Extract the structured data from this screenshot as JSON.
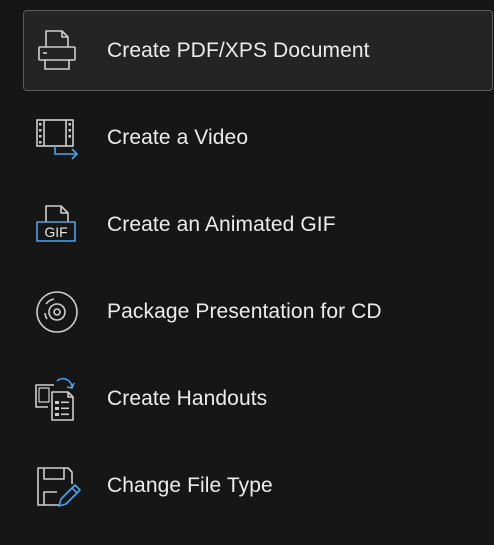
{
  "menu": {
    "items": [
      {
        "label": "Create PDF/XPS Document",
        "icon": "printer-icon",
        "selected": true
      },
      {
        "label": "Create a Video",
        "icon": "video-export-icon",
        "selected": false
      },
      {
        "label": "Create an Animated GIF",
        "icon": "gif-file-icon",
        "selected": false
      },
      {
        "label": "Package Presentation for CD",
        "icon": "cd-disc-icon",
        "selected": false
      },
      {
        "label": "Create Handouts",
        "icon": "handouts-icon",
        "selected": false
      },
      {
        "label": "Change File Type",
        "icon": "save-as-edit-icon",
        "selected": false
      }
    ],
    "gif_badge_text": "GIF"
  },
  "colors": {
    "background": "#161616",
    "selected_background": "#242424",
    "selected_border": "#5b5b5b",
    "text": "#ececec",
    "icon_stroke": "#cfcfcf",
    "accent_blue": "#4aa3f0"
  }
}
